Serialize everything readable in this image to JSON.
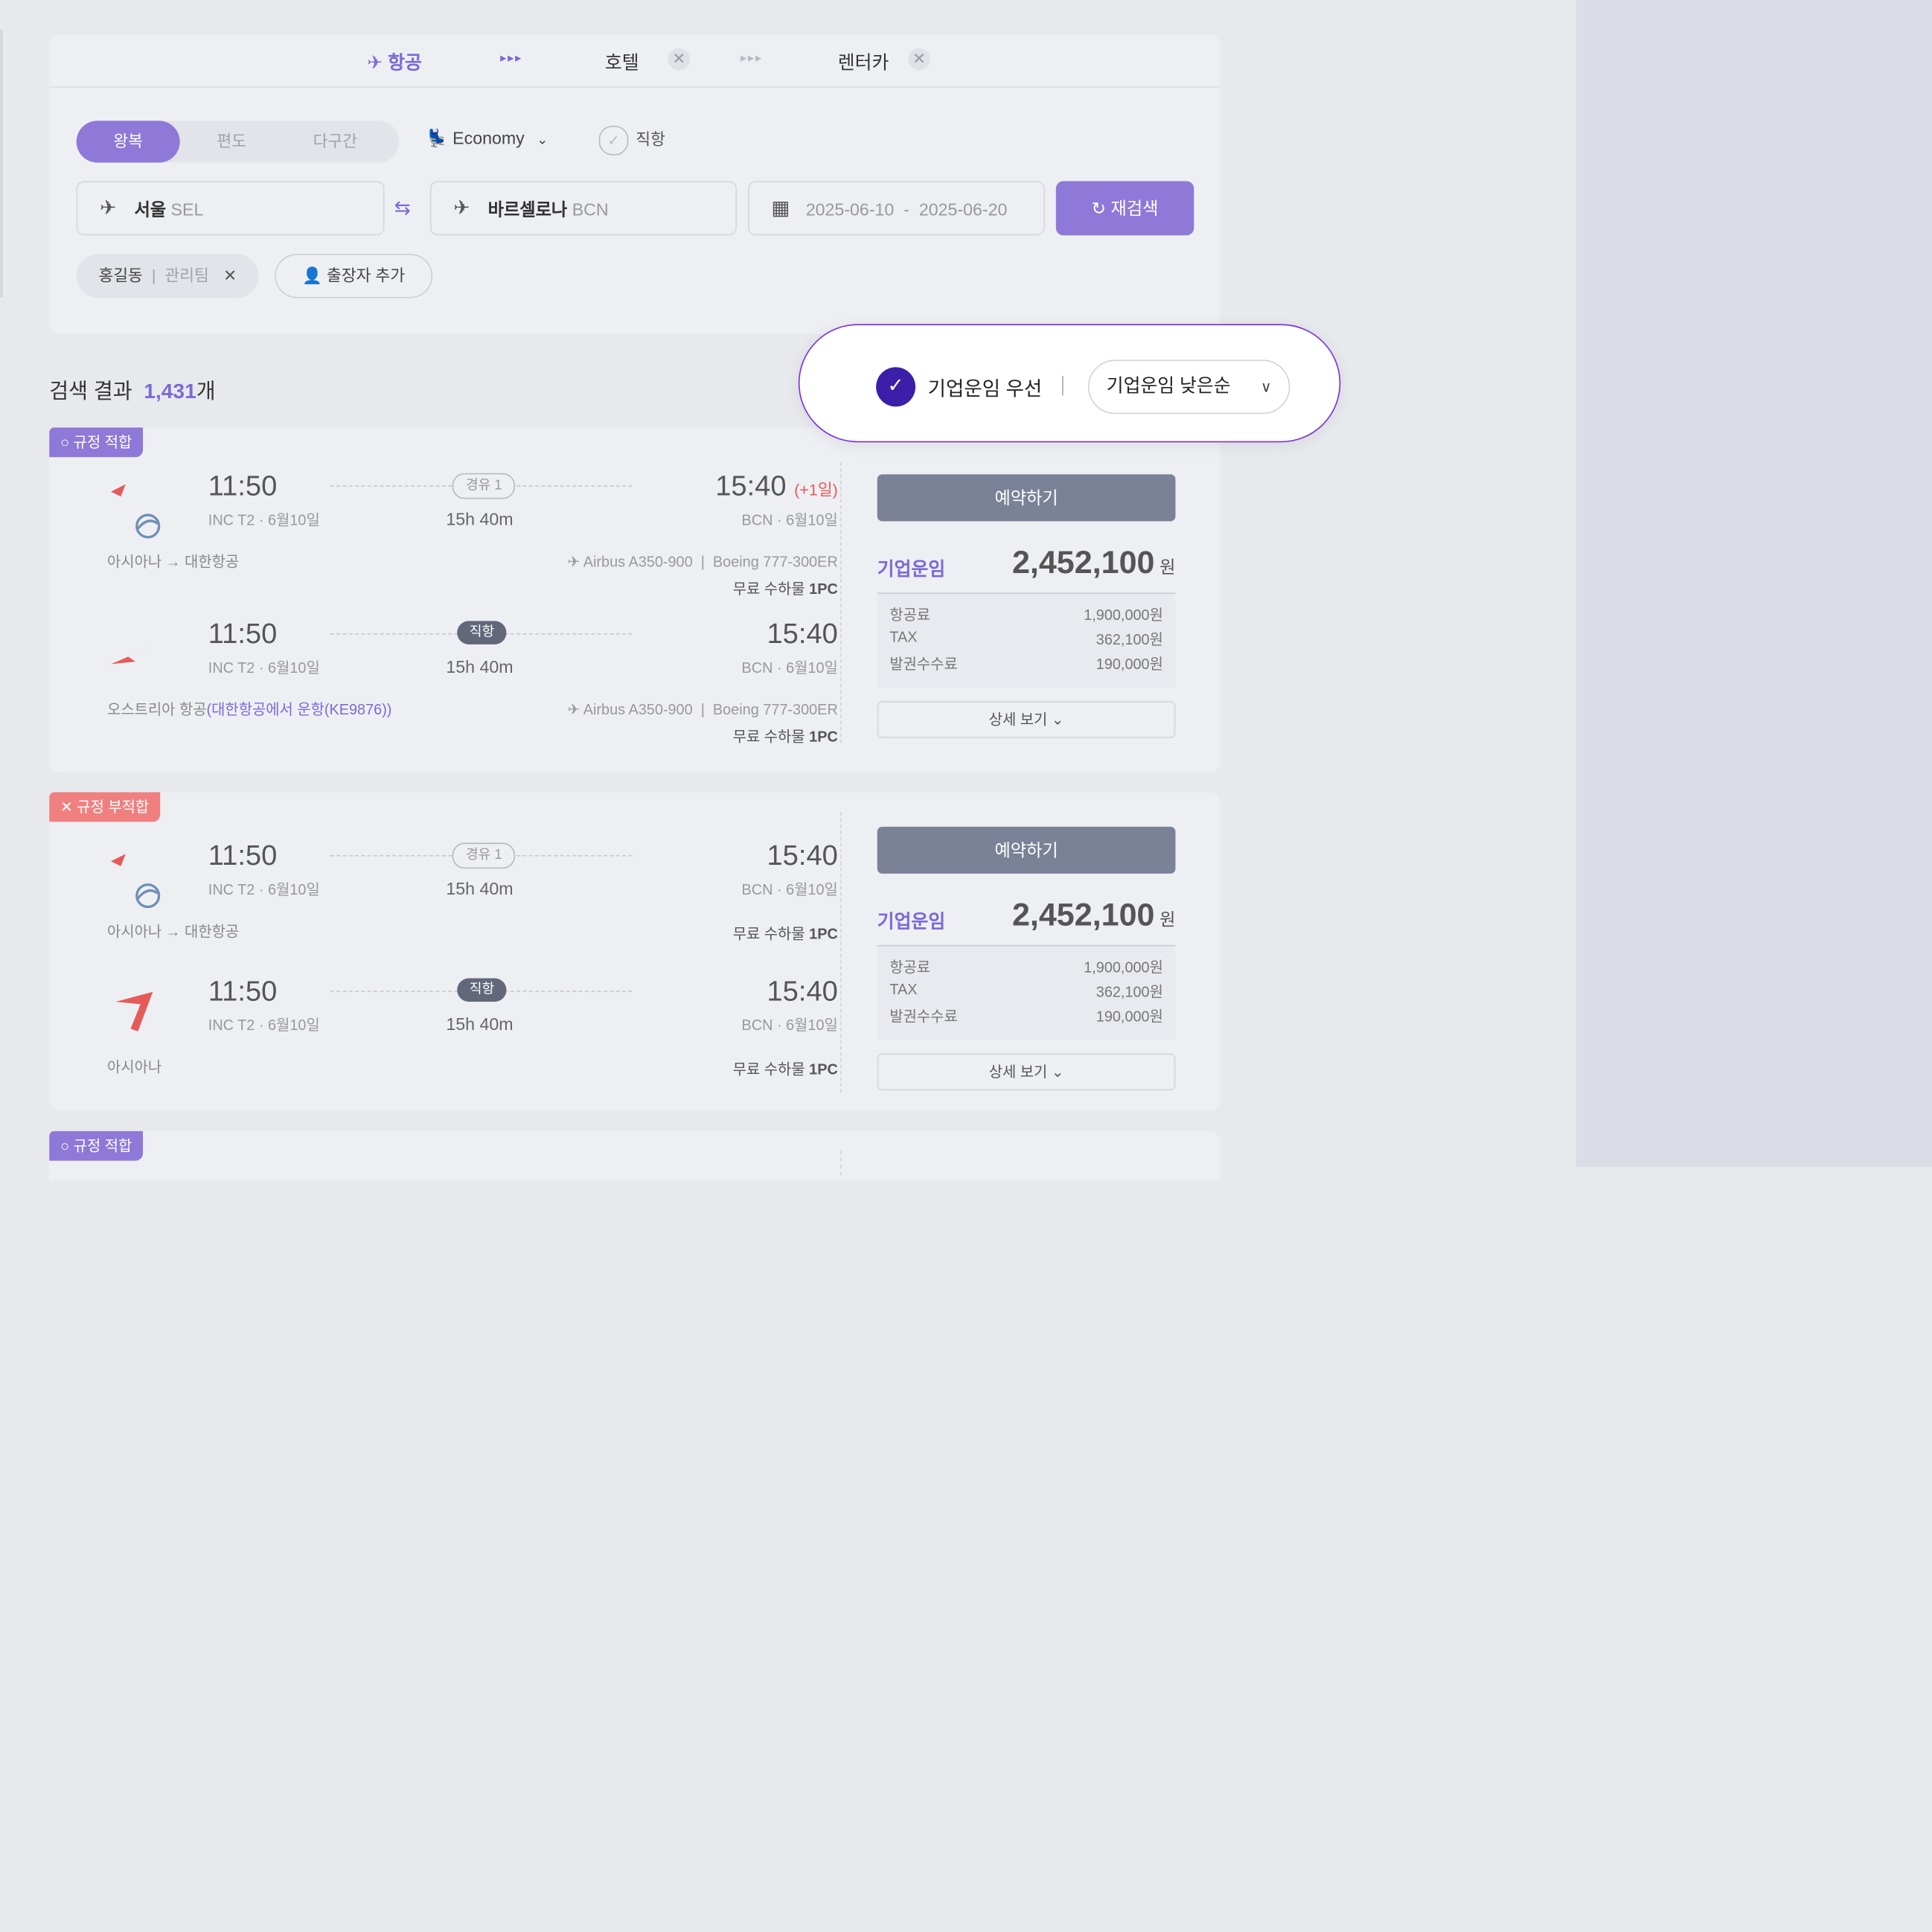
{
  "tabs": {
    "flight": "항공",
    "hotel": "호텔",
    "rental": "렌터카",
    "close_glyph": "✕"
  },
  "trip_types": [
    "왕복",
    "편도",
    "다구간"
  ],
  "cabin": "Economy",
  "direct_label": "직항",
  "origin": {
    "city": "서울",
    "code": "SEL"
  },
  "destination": {
    "city": "바르셀로나",
    "code": "BCN"
  },
  "dates": {
    "start": "2025-06-10",
    "sep": "-",
    "end": "2025-06-20"
  },
  "search_button": "재검색",
  "traveler": {
    "name": "홍길동",
    "team": "관리팀"
  },
  "add_traveler": "출장자 추가",
  "results": {
    "label": "검색 결과",
    "count": "1,431",
    "unit": "개"
  },
  "sort": {
    "preference": "기업운임 우선",
    "option": "기업운임 낮은순"
  },
  "cards": [
    {
      "badge": "규정 적합",
      "legs": [
        {
          "dep_time": "11:50",
          "dep_sub": "INC T2 · 6월10일",
          "stop": "경유 1",
          "duration": "15h 40m",
          "arr_time": "15:40",
          "arr_plus": "(+1일)",
          "arr_sub": "BCN · 6월10일",
          "carrier": "아시아나 → 대한항공",
          "aircraft": "Airbus A350-900",
          "aircraft2": "Boeing 777-300ER",
          "bag_label": "무료 수하물",
          "bag_value": "1PC"
        },
        {
          "dep_time": "11:50",
          "dep_sub": "INC T2 · 6월10일",
          "stop": "직항",
          "duration": "15h 40m",
          "arr_time": "15:40",
          "arr_sub": "BCN · 6월10일",
          "carrier": "오스트리아 항공",
          "carrier_op": "(대한항공에서 운항(KE9876))",
          "aircraft": "Airbus A350-900",
          "aircraft2": "Boeing 777-300ER",
          "bag_label": "무료 수하물",
          "bag_value": "1PC"
        }
      ],
      "fare": {
        "book": "예약하기",
        "label": "기업운임",
        "amount": "2,452,100",
        "currency": "원",
        "rows": [
          [
            "항공료",
            "1,900,000원"
          ],
          [
            "TAX",
            "362,100원"
          ],
          [
            "발권수수료",
            "190,000원"
          ]
        ],
        "detail": "상세 보기"
      }
    },
    {
      "badge": "규정 부적합",
      "legs": [
        {
          "dep_time": "11:50",
          "dep_sub": "INC T2 · 6월10일",
          "stop": "경유 1",
          "duration": "15h 40m",
          "arr_time": "15:40",
          "arr_sub": "BCN · 6월10일",
          "carrier": "아시아나 → 대한항공",
          "bag_label": "무료 수하물",
          "bag_value": "1PC"
        },
        {
          "dep_time": "11:50",
          "dep_sub": "INC T2 · 6월10일",
          "stop": "직항",
          "duration": "15h 40m",
          "arr_time": "15:40",
          "arr_sub": "BCN · 6월10일",
          "carrier": "아시아나",
          "bag_label": "무료 수하물",
          "bag_value": "1PC"
        }
      ],
      "fare": {
        "book": "예약하기",
        "label": "기업운임",
        "amount": "2,452,100",
        "currency": "원",
        "rows": [
          [
            "항공료",
            "1,900,000원"
          ],
          [
            "TAX",
            "362,100원"
          ],
          [
            "발권수수료",
            "190,000원"
          ]
        ],
        "detail": "상세 보기"
      }
    },
    {
      "badge": "규정 적합"
    }
  ],
  "colors": {
    "accent": "#8e79d8",
    "warn": "#f08080",
    "sort_outline": "#7a34d9",
    "sort_check": "#3c1fa8"
  }
}
